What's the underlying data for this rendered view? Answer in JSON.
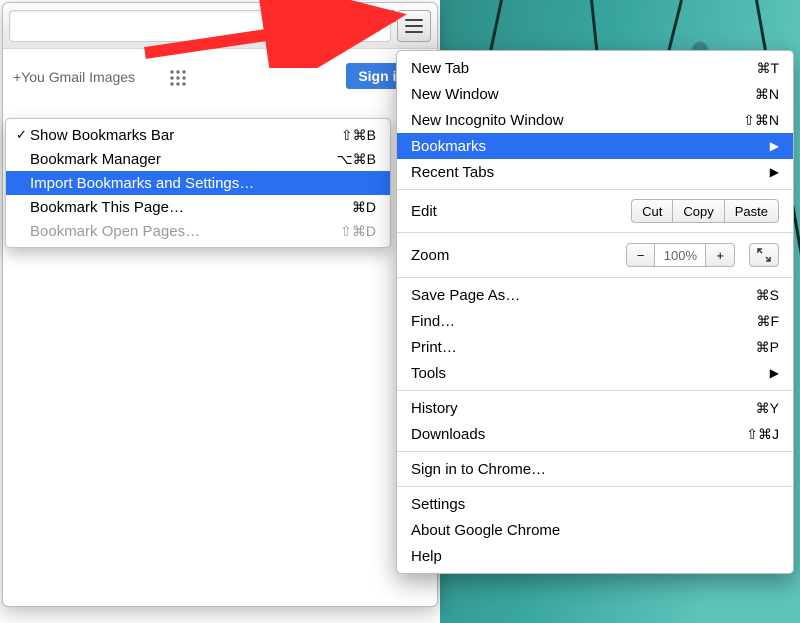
{
  "toolbar": {
    "star_glyph": "☆",
    "hamburger_name": "menu-button"
  },
  "ghost_nav": "+You   Gmail   Images",
  "sign_in": "Sign in",
  "submenu": {
    "items": [
      {
        "checked": true,
        "label": "Show Bookmarks Bar",
        "shortcut": "⇧⌘B",
        "hl": false,
        "disabled": false
      },
      {
        "checked": false,
        "label": "Bookmark Manager",
        "shortcut": "⌥⌘B",
        "hl": false,
        "disabled": false
      },
      {
        "checked": false,
        "label": "Import Bookmarks and Settings…",
        "shortcut": "",
        "hl": true,
        "disabled": false
      },
      {
        "checked": false,
        "label": "Bookmark This Page…",
        "shortcut": "⌘D",
        "hl": false,
        "disabled": false
      },
      {
        "checked": false,
        "label": "Bookmark Open Pages…",
        "shortcut": "⇧⌘D",
        "hl": false,
        "disabled": true
      }
    ]
  },
  "mainmenu": {
    "new_tab": {
      "label": "New Tab",
      "shortcut": "⌘T"
    },
    "new_window": {
      "label": "New Window",
      "shortcut": "⌘N"
    },
    "new_incognito": {
      "label": "New Incognito Window",
      "shortcut": "⇧⌘N"
    },
    "bookmarks": {
      "label": "Bookmarks"
    },
    "recent_tabs": {
      "label": "Recent Tabs"
    },
    "edit": {
      "label": "Edit",
      "cut": "Cut",
      "copy": "Copy",
      "paste": "Paste"
    },
    "zoom": {
      "label": "Zoom",
      "minus": "−",
      "pct": "100%",
      "plus": "+"
    },
    "save_page": {
      "label": "Save Page As…",
      "shortcut": "⌘S"
    },
    "find": {
      "label": "Find…",
      "shortcut": "⌘F"
    },
    "print": {
      "label": "Print…",
      "shortcut": "⌘P"
    },
    "tools": {
      "label": "Tools"
    },
    "history": {
      "label": "History",
      "shortcut": "⌘Y"
    },
    "downloads": {
      "label": "Downloads",
      "shortcut": "⇧⌘J"
    },
    "sign_in_chrome": {
      "label": "Sign in to Chrome…"
    },
    "settings": {
      "label": "Settings"
    },
    "about": {
      "label": "About Google Chrome"
    },
    "help": {
      "label": "Help"
    }
  }
}
